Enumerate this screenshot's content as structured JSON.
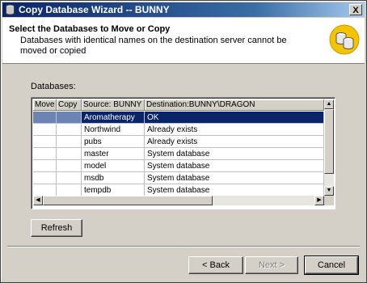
{
  "window": {
    "title": "Copy Database Wizard  -- BUNNY",
    "close_glyph": "X"
  },
  "header": {
    "title": "Select the Databases to Move or Copy",
    "description": "Databases with identical names on the destination server cannot be moved or copied"
  },
  "databases_label": "Databases:",
  "grid": {
    "columns": [
      "Move",
      "Copy",
      "Source: BUNNY",
      "Destination:BUNNY\\DRAGON"
    ],
    "rows": [
      {
        "source": "Aromatherapy",
        "destination": "OK",
        "selected": true
      },
      {
        "source": "Northwind",
        "destination": "Already exists",
        "selected": false
      },
      {
        "source": "pubs",
        "destination": "Already exists",
        "selected": false
      },
      {
        "source": "master",
        "destination": "System database",
        "selected": false
      },
      {
        "source": "model",
        "destination": "System database",
        "selected": false
      },
      {
        "source": "msdb",
        "destination": "System database",
        "selected": false
      },
      {
        "source": "tempdb",
        "destination": "System database",
        "selected": false
      }
    ]
  },
  "buttons": {
    "refresh": "Refresh",
    "back": "< Back",
    "next": "Next >",
    "cancel": "Cancel"
  },
  "colors": {
    "selection": "#0a246a",
    "titlebar_start": "#0a246a",
    "titlebar_end": "#a6caf0"
  },
  "icons": {
    "title_icon": "database-icon",
    "wizard_icon": "database-wizard-icon"
  }
}
